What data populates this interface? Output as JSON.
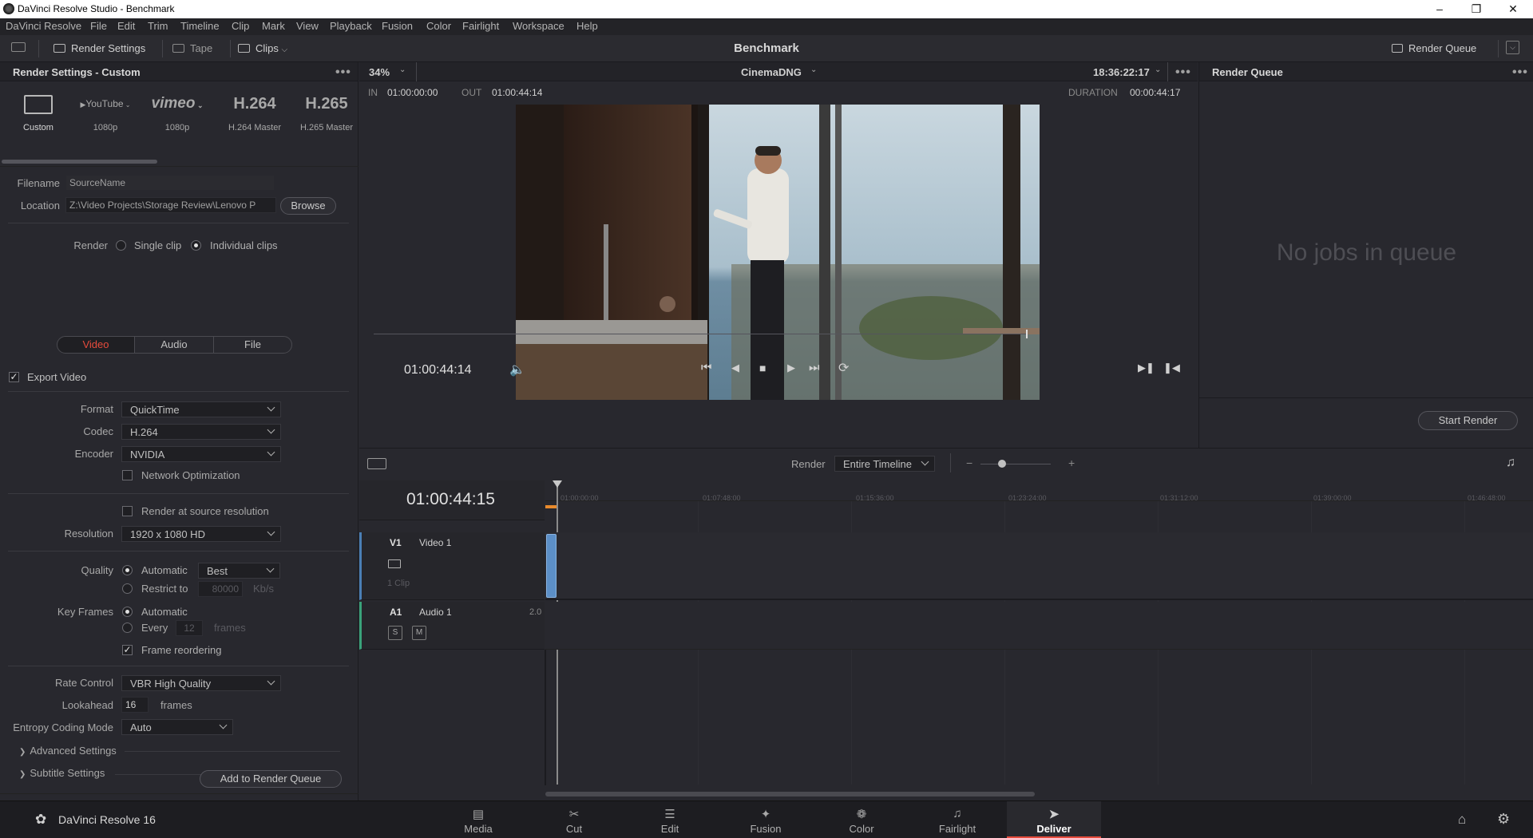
{
  "window": {
    "title": "DaVinci Resolve Studio - Benchmark"
  },
  "menu": [
    "DaVinci Resolve",
    "File",
    "Edit",
    "Trim",
    "Timeline",
    "Clip",
    "Mark",
    "View",
    "Playback",
    "Fusion",
    "Color",
    "Fairlight",
    "Workspace",
    "Help"
  ],
  "toolbar": {
    "render_settings": "Render Settings",
    "tape": "Tape",
    "clips": "Clips",
    "project_title": "Benchmark",
    "render_queue": "Render Queue"
  },
  "render_settings": {
    "header": "Render Settings - Custom",
    "presets": [
      {
        "logo": "",
        "label": "Custom",
        "icon": "film-icon"
      },
      {
        "logo": "YouTube",
        "label": "1080p"
      },
      {
        "logo": "vimeo",
        "label": "1080p"
      },
      {
        "logo": "H.264",
        "label": "H.264 Master"
      },
      {
        "logo": "H.265",
        "label": "H.265 Master"
      }
    ],
    "filename_label": "Filename",
    "filename_value": "SourceName",
    "location_label": "Location",
    "location_value": "Z:\\Video Projects\\Storage Review\\Lenovo P",
    "browse": "Browse",
    "render_label": "Render",
    "single_clip": "Single clip",
    "individual_clips": "Individual clips",
    "tabs": [
      "Video",
      "Audio",
      "File"
    ],
    "export_video": "Export Video",
    "format_label": "Format",
    "format_value": "QuickTime",
    "codec_label": "Codec",
    "codec_value": "H.264",
    "encoder_label": "Encoder",
    "encoder_value": "NVIDIA",
    "network_opt": "Network Optimization",
    "render_source_res": "Render at source resolution",
    "resolution_label": "Resolution",
    "resolution_value": "1920 x 1080 HD",
    "quality_label": "Quality",
    "automatic": "Automatic",
    "quality_value": "Best",
    "restrict_to": "Restrict to",
    "restrict_value": "80000",
    "kbs": "Kb/s",
    "keyframes_label": "Key Frames",
    "kf_automatic": "Automatic",
    "every": "Every",
    "every_value": "12",
    "frames": "frames",
    "frame_reordering": "Frame reordering",
    "rate_control_label": "Rate Control",
    "rate_control_value": "VBR High Quality",
    "lookahead_label": "Lookahead",
    "lookahead_value": "16",
    "lookahead_unit": "frames",
    "entropy_label": "Entropy Coding Mode",
    "entropy_value": "Auto",
    "advanced": "Advanced Settings",
    "subtitle": "Subtitle Settings",
    "add_to_queue": "Add to Render Queue"
  },
  "viewer": {
    "zoom": "34%",
    "clip_name": "CinemaDNG",
    "timecode_top": "18:36:22:17",
    "in_label": "IN",
    "in_value": "01:00:00:00",
    "out_label": "OUT",
    "out_value": "01:00:44:14",
    "duration_label": "DURATION",
    "duration_value": "00:00:44:17",
    "current_tc": "01:00:44:14"
  },
  "render_queue": {
    "header": "Render Queue",
    "empty": "No jobs in queue",
    "start": "Start Render"
  },
  "timeline": {
    "render_label": "Render",
    "render_value": "Entire Timeline",
    "timecode": "01:00:44:15",
    "ruler": [
      "01:00:00:00",
      "01:07:48:00",
      "01:15:36:00",
      "01:23:24:00",
      "01:31:12:00",
      "01:39:00:00",
      "01:46:48:00"
    ],
    "v1_id": "V1",
    "v1_name": "Video 1",
    "v1_clips": "1 Clip",
    "a1_id": "A1",
    "a1_name": "Audio 1",
    "a1_ch": "2.0",
    "solo": "S",
    "mute": "M"
  },
  "bottom": {
    "app_name": "DaVinci Resolve 16",
    "pages": [
      "Media",
      "Cut",
      "Edit",
      "Fusion",
      "Color",
      "Fairlight",
      "Deliver"
    ],
    "active_page": "Deliver"
  },
  "colors": {
    "accent": "#e64b3c",
    "bg": "#28282e"
  }
}
